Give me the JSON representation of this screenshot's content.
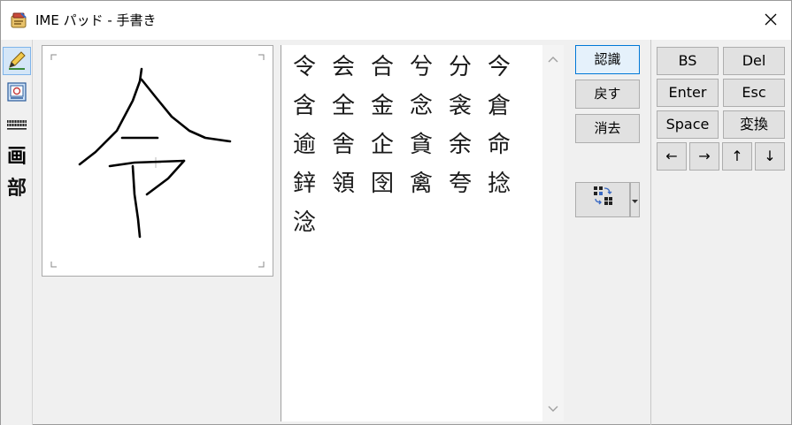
{
  "window": {
    "title": "IME パッド - 手書き",
    "app_icon": "ime-pad-icon",
    "close_icon": "close-icon"
  },
  "left_toolbar": {
    "items": [
      {
        "name": "handwriting-tool",
        "icon": "pen-icon",
        "active": true
      },
      {
        "name": "character-list-tool",
        "icon": "char-list-icon",
        "active": false
      },
      {
        "name": "soft-keyboard-tool",
        "icon": "keyboard-icon",
        "active": false
      },
      {
        "name": "stroke-count-tool",
        "label": "画",
        "active": false
      },
      {
        "name": "radical-tool",
        "label": "部",
        "active": false
      }
    ]
  },
  "candidates": [
    "令",
    "会",
    "合",
    "兮",
    "分",
    "今",
    "含",
    "全",
    "金",
    "念",
    "衾",
    "倉",
    "逾",
    "舎",
    "企",
    "貪",
    "余",
    "命",
    "鋅",
    "領",
    "囹",
    "禽",
    "夸",
    "捻",
    "淰"
  ],
  "actions": {
    "recognize": "認識",
    "undo": "戻す",
    "clear": "消去",
    "recognize_mode_icon": "grid-pen-icon",
    "dropdown_icon": "chevron-down-icon"
  },
  "keys": {
    "bs": "BS",
    "del": "Del",
    "enter": "Enter",
    "esc": "Esc",
    "space": "Space",
    "convert": "変換",
    "left": "←",
    "right": "→",
    "up": "↑",
    "down": "↓"
  },
  "colors": {
    "accent": "#0078d7",
    "active_tool_bg": "#d4e6f7"
  }
}
